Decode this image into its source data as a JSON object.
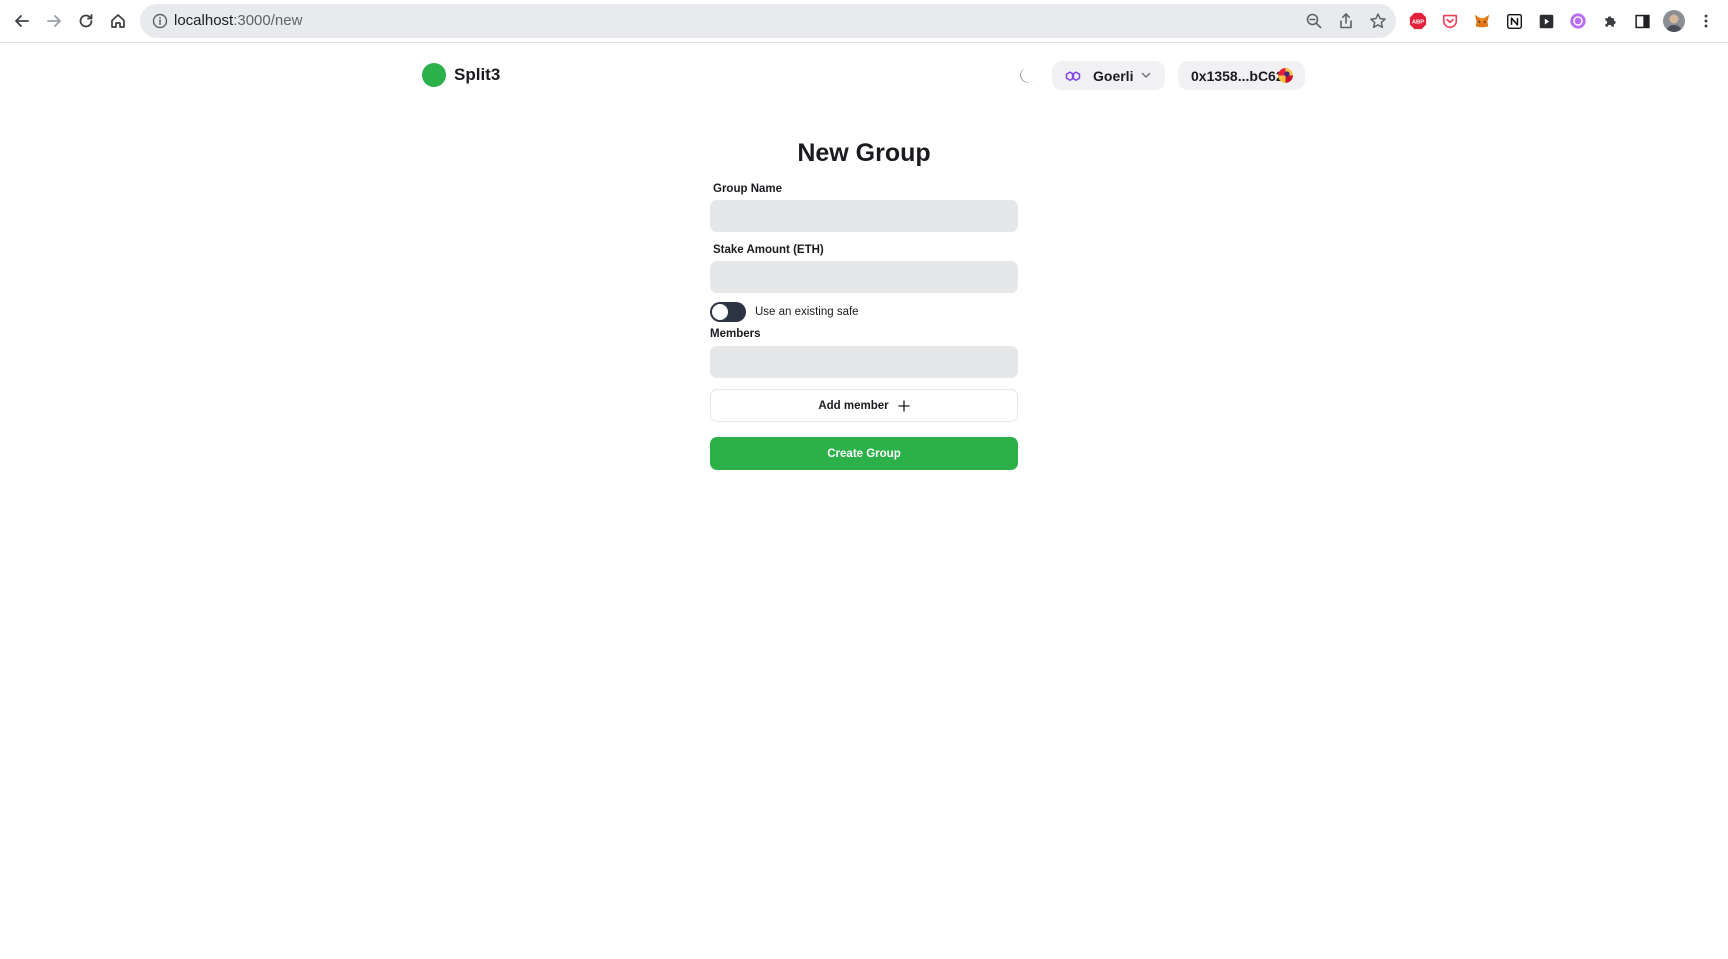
{
  "browser": {
    "url_host": "localhost",
    "url_path": ":3000/new",
    "extensions": [
      "adblock-plus-icon",
      "pocket-icon",
      "metamask-icon",
      "notion-icon",
      "screen-capture-icon",
      "purple-extension-icon",
      "puzzle-icon",
      "sidepanel-icon",
      "profile-avatar",
      "more-icon"
    ]
  },
  "header": {
    "app_name": "Split3",
    "network": "Goerli",
    "account": "0x1358...bC62"
  },
  "form": {
    "title": "New Group",
    "group_name_label": "Group Name",
    "group_name_value": "",
    "stake_label": "Stake Amount (ETH)",
    "stake_value": "",
    "toggle_label": "Use an existing safe",
    "toggle_on": false,
    "members_label": "Members",
    "member_value": "",
    "add_member_label": "Add member",
    "create_label": "Create Group"
  },
  "colors": {
    "brand_green": "#2bb04a",
    "toggle_track": "#2c3444",
    "input_bg": "#e6e7e8",
    "polygon_purple": "#8247e5"
  }
}
